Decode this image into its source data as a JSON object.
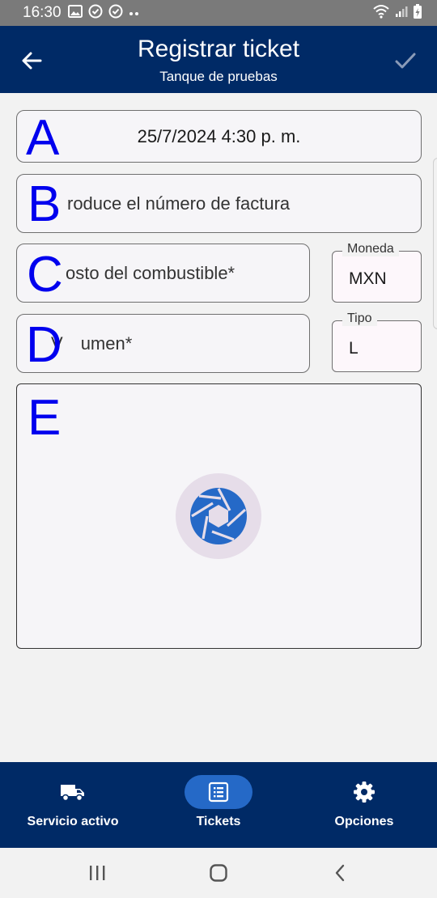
{
  "status_bar": {
    "time": "16:30",
    "icons": [
      "image-icon",
      "check-circle-icon",
      "check-circle-icon",
      "more-dots-icon",
      "wifi-icon",
      "signal-icon",
      "battery-charging-icon"
    ]
  },
  "app_bar": {
    "title": "Registrar ticket",
    "subtitle": "Tanque de pruebas"
  },
  "form": {
    "date_value": "25/7/2024 4:30 p. m.",
    "invoice_placeholder": "Introduce el número de factura",
    "invoice_visible": "roduce el número de factura",
    "cost_placeholder": "Costo del combustible*",
    "cost_visible": "osto del combustible*",
    "currency_label": "Moneda",
    "currency_value": "MXN",
    "volume_placeholder": "Volumen*",
    "volume_visible_a": "V",
    "volume_visible_b": "umen*",
    "unit_label": "Tipo",
    "unit_value": "L"
  },
  "markers": [
    "A",
    "B",
    "C",
    "D",
    "E"
  ],
  "bottom_nav": {
    "items": [
      {
        "label": "Servicio activo",
        "icon": "truck-icon",
        "active": false
      },
      {
        "label": "Tickets",
        "icon": "list-icon",
        "active": true
      },
      {
        "label": "Opciones",
        "icon": "gear-icon",
        "active": false
      }
    ]
  },
  "colors": {
    "primary": "#002a66",
    "accent": "#2569c7",
    "camera_icon": "#2569c7",
    "camera_bg": "#e6dde9",
    "marker": "#0000ee"
  }
}
